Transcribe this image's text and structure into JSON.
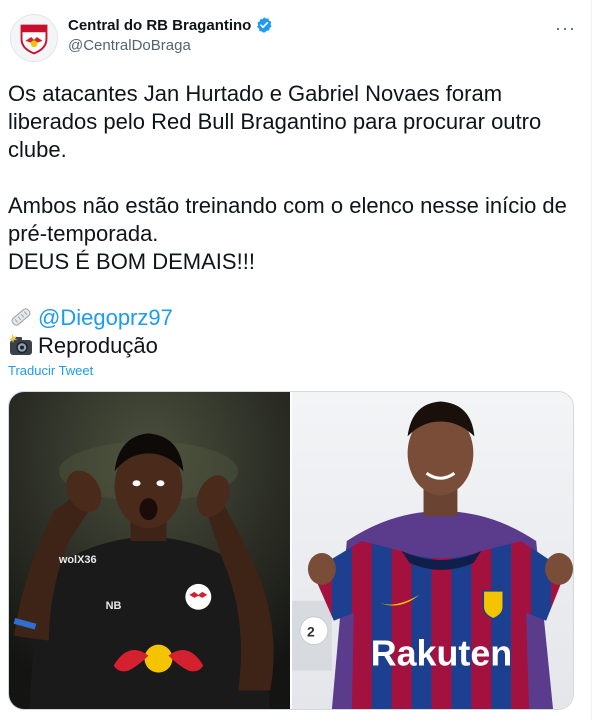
{
  "account": {
    "display_name": "Central do RB Bragantino",
    "handle": "@CentralDoBraga",
    "verified": true,
    "avatar_icon": "bragantino-crest-icon"
  },
  "more_icon": "more-options-icon",
  "tweet": {
    "paragraph1": "Os atacantes Jan Hurtado e Gabriel Novaes foram liberados pelo Red Bull Bragantino para procurar outro clube.",
    "paragraph2_line1": "Ambos não estão treinando com o elenco nesse início de pré-temporada.",
    "paragraph2_line2": "DEUS É BOM DEMAIS!!!",
    "credit_mention": "@Diegoprz97",
    "credit_icon": "newspaper-icon",
    "photo_icon": "camera-flash-icon",
    "photo_credit": "Reprodução"
  },
  "translate_label": "Traducir Tweet",
  "media": {
    "photo_left": "player-in-black-kit-photo",
    "photo_right": "player-holding-barcelona-shirt-photo",
    "shirt_sponsor": "Rakuten",
    "colors": {
      "barca_blue": "#1d3f8f",
      "barca_red": "#a3123f",
      "kit_black": "#1a1a1a"
    }
  },
  "colors": {
    "accent": "#1d9bf0",
    "text": "#0f1419",
    "muted": "#536471"
  }
}
